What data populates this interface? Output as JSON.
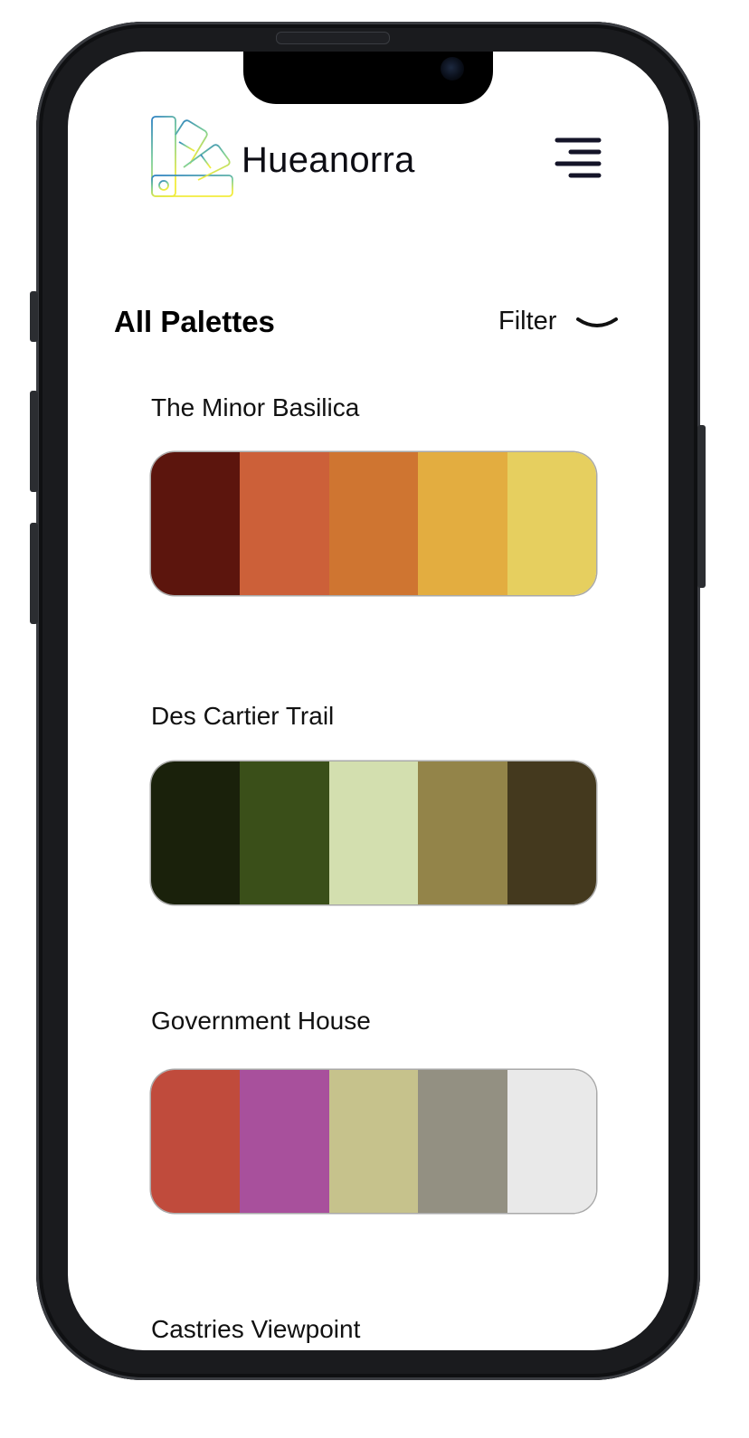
{
  "app": {
    "name": "Hueanorra",
    "logo_icon": "color-swatch-fan-icon",
    "menu_icon": "hamburger-menu-icon"
  },
  "section": {
    "title": "All Palettes",
    "filter_label": "Filter",
    "filter_icon": "chevron-down-icon"
  },
  "palettes": [
    {
      "name": "The Minor Basilica",
      "colors": [
        "#5c150d",
        "#cc6039",
        "#cf7531",
        "#e3ad40",
        "#e6cf5f"
      ]
    },
    {
      "name": "Des Cartier Trail",
      "colors": [
        "#1a210b",
        "#3a4f19",
        "#d3dfaf",
        "#938449",
        "#44391e"
      ]
    },
    {
      "name": "Government House",
      "colors": [
        "#c04b3c",
        "#a8509c",
        "#c6c28c",
        "#939082",
        "#e9e9e9"
      ]
    },
    {
      "name": "Castries Viewpoint",
      "colors": []
    }
  ]
}
